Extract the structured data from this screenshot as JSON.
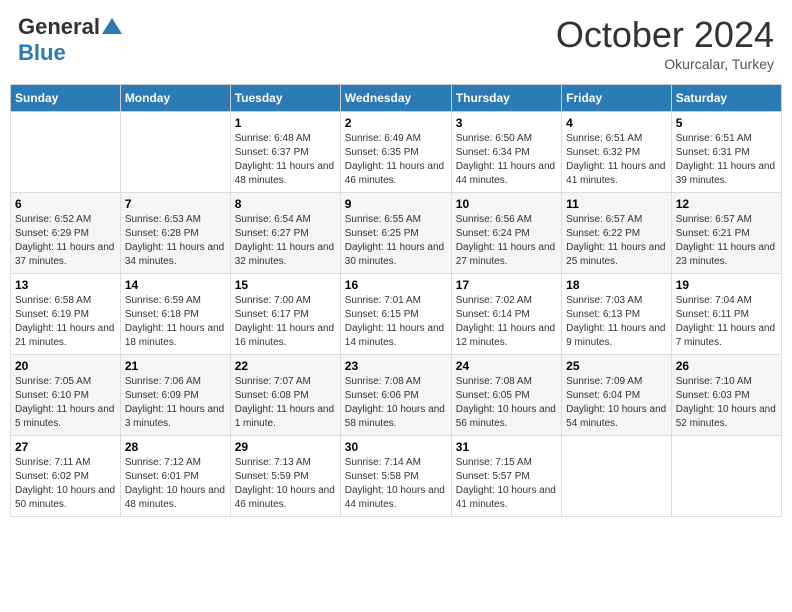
{
  "header": {
    "logo_general": "General",
    "logo_blue": "Blue",
    "month_title": "October 2024",
    "location": "Okurcalar, Turkey"
  },
  "days_of_week": [
    "Sunday",
    "Monday",
    "Tuesday",
    "Wednesday",
    "Thursday",
    "Friday",
    "Saturday"
  ],
  "weeks": [
    [
      {
        "day": "",
        "sunrise": "",
        "sunset": "",
        "daylight": ""
      },
      {
        "day": "",
        "sunrise": "",
        "sunset": "",
        "daylight": ""
      },
      {
        "day": "1",
        "sunrise": "Sunrise: 6:48 AM",
        "sunset": "Sunset: 6:37 PM",
        "daylight": "Daylight: 11 hours and 48 minutes."
      },
      {
        "day": "2",
        "sunrise": "Sunrise: 6:49 AM",
        "sunset": "Sunset: 6:35 PM",
        "daylight": "Daylight: 11 hours and 46 minutes."
      },
      {
        "day": "3",
        "sunrise": "Sunrise: 6:50 AM",
        "sunset": "Sunset: 6:34 PM",
        "daylight": "Daylight: 11 hours and 44 minutes."
      },
      {
        "day": "4",
        "sunrise": "Sunrise: 6:51 AM",
        "sunset": "Sunset: 6:32 PM",
        "daylight": "Daylight: 11 hours and 41 minutes."
      },
      {
        "day": "5",
        "sunrise": "Sunrise: 6:51 AM",
        "sunset": "Sunset: 6:31 PM",
        "daylight": "Daylight: 11 hours and 39 minutes."
      }
    ],
    [
      {
        "day": "6",
        "sunrise": "Sunrise: 6:52 AM",
        "sunset": "Sunset: 6:29 PM",
        "daylight": "Daylight: 11 hours and 37 minutes."
      },
      {
        "day": "7",
        "sunrise": "Sunrise: 6:53 AM",
        "sunset": "Sunset: 6:28 PM",
        "daylight": "Daylight: 11 hours and 34 minutes."
      },
      {
        "day": "8",
        "sunrise": "Sunrise: 6:54 AM",
        "sunset": "Sunset: 6:27 PM",
        "daylight": "Daylight: 11 hours and 32 minutes."
      },
      {
        "day": "9",
        "sunrise": "Sunrise: 6:55 AM",
        "sunset": "Sunset: 6:25 PM",
        "daylight": "Daylight: 11 hours and 30 minutes."
      },
      {
        "day": "10",
        "sunrise": "Sunrise: 6:56 AM",
        "sunset": "Sunset: 6:24 PM",
        "daylight": "Daylight: 11 hours and 27 minutes."
      },
      {
        "day": "11",
        "sunrise": "Sunrise: 6:57 AM",
        "sunset": "Sunset: 6:22 PM",
        "daylight": "Daylight: 11 hours and 25 minutes."
      },
      {
        "day": "12",
        "sunrise": "Sunrise: 6:57 AM",
        "sunset": "Sunset: 6:21 PM",
        "daylight": "Daylight: 11 hours and 23 minutes."
      }
    ],
    [
      {
        "day": "13",
        "sunrise": "Sunrise: 6:58 AM",
        "sunset": "Sunset: 6:19 PM",
        "daylight": "Daylight: 11 hours and 21 minutes."
      },
      {
        "day": "14",
        "sunrise": "Sunrise: 6:59 AM",
        "sunset": "Sunset: 6:18 PM",
        "daylight": "Daylight: 11 hours and 18 minutes."
      },
      {
        "day": "15",
        "sunrise": "Sunrise: 7:00 AM",
        "sunset": "Sunset: 6:17 PM",
        "daylight": "Daylight: 11 hours and 16 minutes."
      },
      {
        "day": "16",
        "sunrise": "Sunrise: 7:01 AM",
        "sunset": "Sunset: 6:15 PM",
        "daylight": "Daylight: 11 hours and 14 minutes."
      },
      {
        "day": "17",
        "sunrise": "Sunrise: 7:02 AM",
        "sunset": "Sunset: 6:14 PM",
        "daylight": "Daylight: 11 hours and 12 minutes."
      },
      {
        "day": "18",
        "sunrise": "Sunrise: 7:03 AM",
        "sunset": "Sunset: 6:13 PM",
        "daylight": "Daylight: 11 hours and 9 minutes."
      },
      {
        "day": "19",
        "sunrise": "Sunrise: 7:04 AM",
        "sunset": "Sunset: 6:11 PM",
        "daylight": "Daylight: 11 hours and 7 minutes."
      }
    ],
    [
      {
        "day": "20",
        "sunrise": "Sunrise: 7:05 AM",
        "sunset": "Sunset: 6:10 PM",
        "daylight": "Daylight: 11 hours and 5 minutes."
      },
      {
        "day": "21",
        "sunrise": "Sunrise: 7:06 AM",
        "sunset": "Sunset: 6:09 PM",
        "daylight": "Daylight: 11 hours and 3 minutes."
      },
      {
        "day": "22",
        "sunrise": "Sunrise: 7:07 AM",
        "sunset": "Sunset: 6:08 PM",
        "daylight": "Daylight: 11 hours and 1 minute."
      },
      {
        "day": "23",
        "sunrise": "Sunrise: 7:08 AM",
        "sunset": "Sunset: 6:06 PM",
        "daylight": "Daylight: 10 hours and 58 minutes."
      },
      {
        "day": "24",
        "sunrise": "Sunrise: 7:08 AM",
        "sunset": "Sunset: 6:05 PM",
        "daylight": "Daylight: 10 hours and 56 minutes."
      },
      {
        "day": "25",
        "sunrise": "Sunrise: 7:09 AM",
        "sunset": "Sunset: 6:04 PM",
        "daylight": "Daylight: 10 hours and 54 minutes."
      },
      {
        "day": "26",
        "sunrise": "Sunrise: 7:10 AM",
        "sunset": "Sunset: 6:03 PM",
        "daylight": "Daylight: 10 hours and 52 minutes."
      }
    ],
    [
      {
        "day": "27",
        "sunrise": "Sunrise: 7:11 AM",
        "sunset": "Sunset: 6:02 PM",
        "daylight": "Daylight: 10 hours and 50 minutes."
      },
      {
        "day": "28",
        "sunrise": "Sunrise: 7:12 AM",
        "sunset": "Sunset: 6:01 PM",
        "daylight": "Daylight: 10 hours and 48 minutes."
      },
      {
        "day": "29",
        "sunrise": "Sunrise: 7:13 AM",
        "sunset": "Sunset: 5:59 PM",
        "daylight": "Daylight: 10 hours and 46 minutes."
      },
      {
        "day": "30",
        "sunrise": "Sunrise: 7:14 AM",
        "sunset": "Sunset: 5:58 PM",
        "daylight": "Daylight: 10 hours and 44 minutes."
      },
      {
        "day": "31",
        "sunrise": "Sunrise: 7:15 AM",
        "sunset": "Sunset: 5:57 PM",
        "daylight": "Daylight: 10 hours and 41 minutes."
      },
      {
        "day": "",
        "sunrise": "",
        "sunset": "",
        "daylight": ""
      },
      {
        "day": "",
        "sunrise": "",
        "sunset": "",
        "daylight": ""
      }
    ]
  ]
}
